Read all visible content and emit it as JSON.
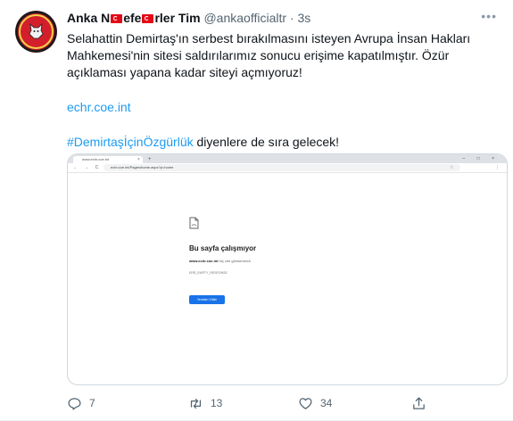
{
  "tweet": {
    "author": {
      "name_part1": "Anka N",
      "name_part2": "efe",
      "name_part3": "rler Tim",
      "handle": "@ankaofficialtr",
      "separator": "·",
      "time": "3s"
    },
    "more_icon": "more-horizontal-icon",
    "text": {
      "para1": "Selahattin Demirtaş'ın serbest bırakılmasını isteyen Avrupa İnsan Hakları Mahkemesi'nin sitesi saldırılarımız sonucu erişime kapatılmıştır. Özür açıklaması yapana kadar siteyi açmıyoruz!",
      "link": "echr.coe.int",
      "hashtag": "#DemirtaşİçinÖzgürlük",
      "para3_rest": " diyenlere de sıra gelecek!"
    },
    "media": {
      "browser": {
        "tab_title": "www.echr.coe.int",
        "tab_close": "×",
        "new_tab": "+",
        "window_controls": "– □ ×",
        "nav_buttons": "← → C",
        "url": "echr.coe.int/Pages/home.aspx?p=home",
        "menu": "⋮"
      },
      "error": {
        "title": "Bu sayfa çalışmıyor",
        "domain": "www.echr.coe.int",
        "desc_rest": " hiç veri göndermedi.",
        "code": "ERR_EMPTY_RESPONSE",
        "button": "Yeniden Yükle"
      }
    },
    "actions": {
      "reply_icon": "reply-icon",
      "reply_count": "7",
      "retweet_icon": "retweet-icon",
      "retweet_count": "13",
      "like_icon": "heart-icon",
      "like_count": "34",
      "share_icon": "share-icon"
    }
  }
}
